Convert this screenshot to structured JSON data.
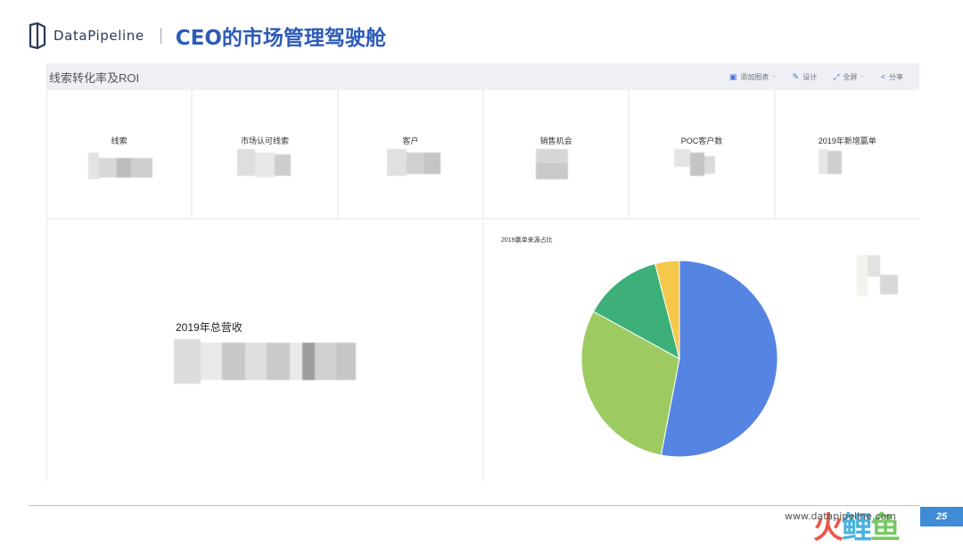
{
  "brand": {
    "name": "DataPipeline",
    "title": "CEO的市场管理驾驶舱"
  },
  "panel": {
    "title": "线索转化率及ROI",
    "toolbar": [
      {
        "icon": "add-chart-icon",
        "label": "添加图表",
        "caret": true
      },
      {
        "icon": "design-icon",
        "label": "设计",
        "caret": false
      },
      {
        "icon": "fullscreen-icon",
        "label": "全屏",
        "caret": true
      },
      {
        "icon": "share-icon",
        "label": "分享",
        "caret": false
      }
    ]
  },
  "kpis": [
    {
      "label": "线索"
    },
    {
      "label": "市场认可线索"
    },
    {
      "label": "客户"
    },
    {
      "label": "销售机会"
    },
    {
      "label": "POC客户数"
    },
    {
      "label": "2019年新增赢单"
    }
  ],
  "revenue": {
    "label": "2019年总营收"
  },
  "chart_data": {
    "type": "pie",
    "title": "2019赢单来源占比",
    "slices": [
      {
        "value": 53,
        "color": "#5584e3"
      },
      {
        "value": 30,
        "color": "#9dcb62"
      },
      {
        "value": 13,
        "color": "#3daf78"
      },
      {
        "value": 4,
        "color": "#f5c84c"
      }
    ]
  },
  "footer": {
    "url": "www.datapipeline.com",
    "page": "25",
    "watermark": [
      "火",
      "鲤",
      "鱼"
    ]
  }
}
